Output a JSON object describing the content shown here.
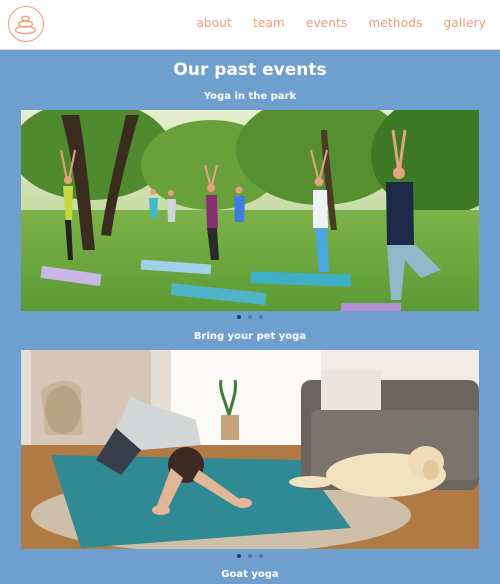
{
  "nav": {
    "items": [
      {
        "label": "about"
      },
      {
        "label": "team"
      },
      {
        "label": "events"
      },
      {
        "label": "methods"
      },
      {
        "label": "gallery"
      }
    ]
  },
  "main": {
    "title": "Our past events",
    "events": [
      {
        "caption": "Yoga in the park",
        "active_slide": 1,
        "slide_count": 3
      },
      {
        "caption": "Bring your pet yoga",
        "active_slide": 1,
        "slide_count": 3
      },
      {
        "caption": "Goat yoga"
      }
    ]
  },
  "colors": {
    "accent": "#ef9b78",
    "page_background": "#6f9fcf",
    "header_background": "#ffffff"
  },
  "icons": {
    "logo": "stacked-stones-icon"
  }
}
